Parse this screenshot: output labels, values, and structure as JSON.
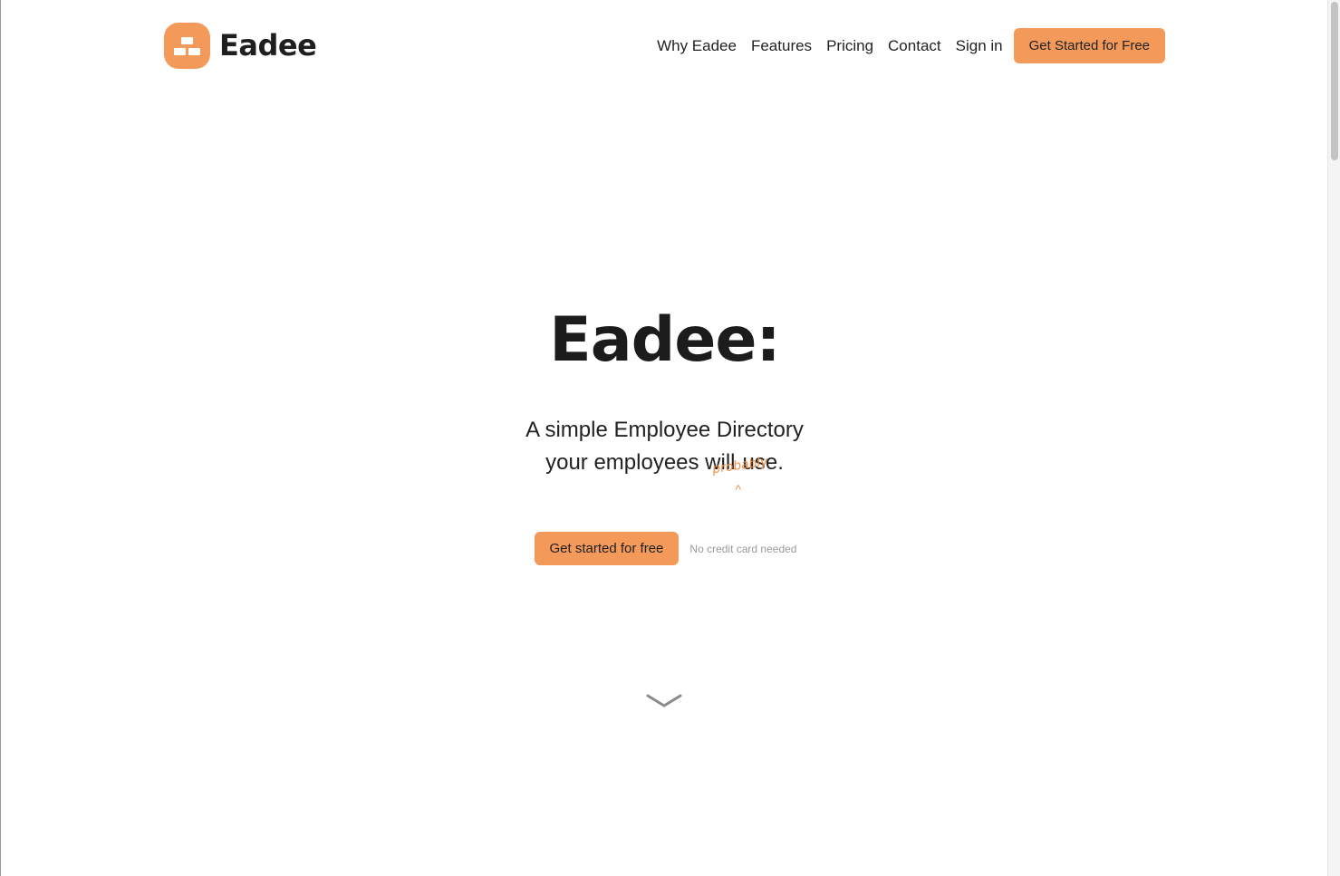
{
  "brand": {
    "name": "Eadee",
    "logo_icon": "bricks-logo-icon",
    "accent_color": "#f39a5a"
  },
  "nav": {
    "items": [
      {
        "label": "Why Eadee"
      },
      {
        "label": "Features"
      },
      {
        "label": "Pricing"
      },
      {
        "label": "Contact"
      },
      {
        "label": "Sign in"
      }
    ],
    "cta_label": "Get Started for Free"
  },
  "hero": {
    "title": "Eadee:",
    "subtitle_line1": "A simple Employee Directory",
    "subtitle_line2_before": "your employees will",
    "subtitle_line2_after": "use.",
    "handwritten_insert": "probably",
    "caret": "^",
    "cta_label": "Get started for free",
    "note": "No credit card needed",
    "scroll_icon": "chevron-down-icon"
  }
}
